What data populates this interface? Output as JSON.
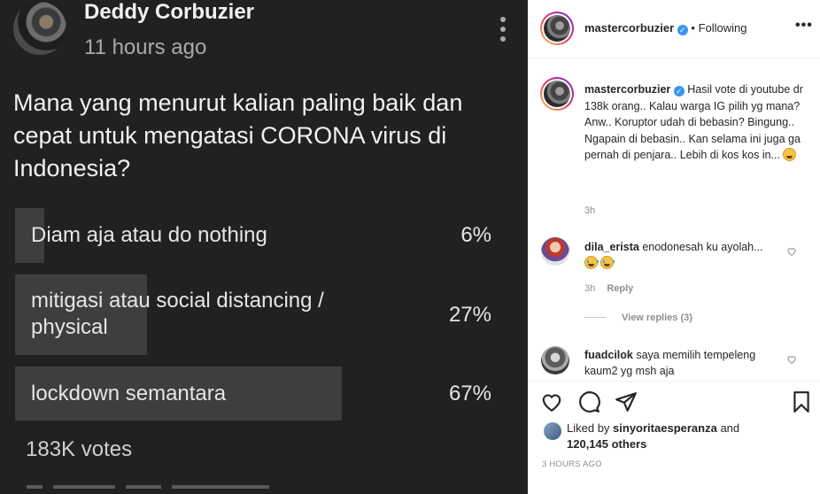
{
  "youtube_post": {
    "author": "Deddy Corbuzier",
    "time": "11 hours ago",
    "question": "Mana yang menurut kalian paling baik dan cepat untuk mengatasi CORONA virus di Indonesia?",
    "poll": [
      {
        "label": "Diam aja atau do nothing",
        "percent_label": "6%",
        "percent": 6
      },
      {
        "label": "mitigasi atau social distancing / physical",
        "percent_label": "27%",
        "percent": 27
      },
      {
        "label": "lockdown semantara",
        "percent_label": "67%",
        "percent": 67
      }
    ],
    "votes": "183K votes"
  },
  "instagram": {
    "header": {
      "username": "mastercorbuzier",
      "separator": "•",
      "follow_status": "Following"
    },
    "caption": {
      "username": "mastercorbuzier",
      "text": "Hasil vote di youtube dr 138k orang.. Kalau warga IG pilih yg mana? Anw.. Koruptor udah di bebasin? Bingung.. Ngapain di bebasin.. Kan selama ini juga ga pernah di penjara.. Lebih di kos kos in...",
      "time": "3h"
    },
    "comments": [
      {
        "username": "dila_erista",
        "text": "enodonesah ku ayolah...",
        "time": "3h",
        "reply": "Reply",
        "view_replies": "View replies (3)"
      },
      {
        "username": "fuadcilok",
        "text": "saya memilih tempeleng kaum2 yg msh aja"
      }
    ],
    "likes": {
      "prefix": "Liked by",
      "user": "sinyoritaesperanza",
      "and": "and",
      "others": "120,145 others"
    },
    "timestamp": "3 HOURS AGO"
  }
}
